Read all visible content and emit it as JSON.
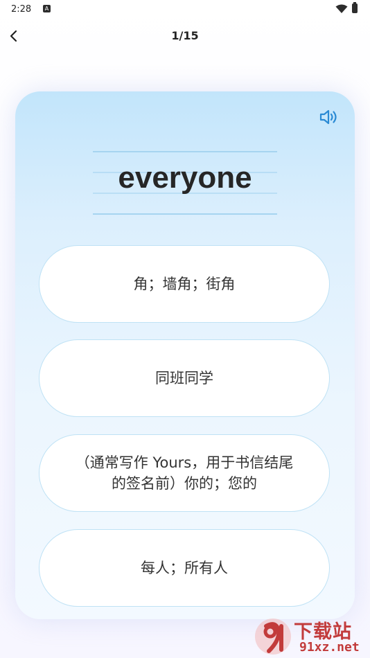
{
  "status_bar": {
    "time": "2:28",
    "notification_icon_letter": "A"
  },
  "header": {
    "progress": "1/15"
  },
  "card": {
    "word": "everyone",
    "options": [
      "角；墙角；街角",
      "同班同学",
      "（通常写作 Yours，用于书信结尾的签名前）你的；您的",
      "每人；所有人"
    ]
  },
  "watermark": {
    "name": "下载站",
    "url": "91xz.net"
  },
  "colors": {
    "card_top": "#c2e5fb",
    "card_bottom": "#f3f9ff",
    "option_border": "#bfe2f5",
    "speaker": "#2a8ad4",
    "watermark": "#c23b3b"
  },
  "icons": [
    "back-arrow-icon",
    "speaker-icon",
    "wifi-icon",
    "battery-icon"
  ]
}
